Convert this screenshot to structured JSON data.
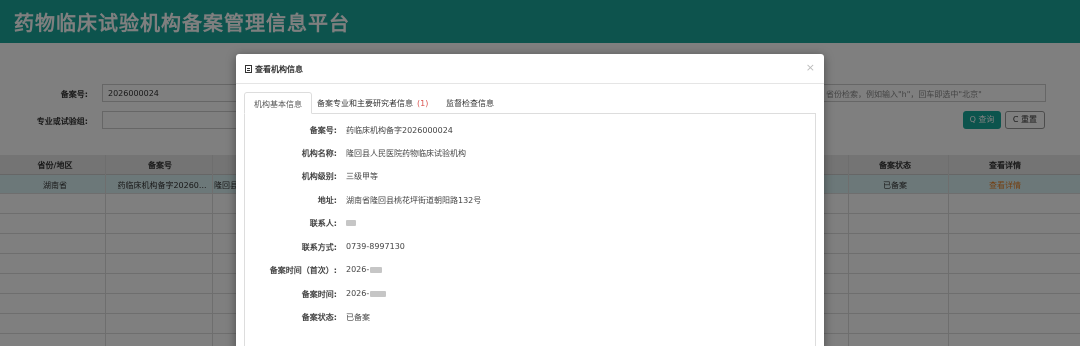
{
  "app": {
    "title": "药物临床试验机构备案管理信息平台"
  },
  "search": {
    "record_no_label": "备案号:",
    "record_no_value": "2026000024",
    "major_label": "专业或试验组:",
    "major_value": "",
    "region_placeholder": "省份检索，例如输入\"h\"，回车即选中\"北京\"",
    "search_btn": "Q 查询",
    "reset_btn": "C 重置"
  },
  "table": {
    "headers": [
      "省份/地区",
      "备案号",
      "备案状态",
      "查看详情"
    ],
    "rows": [
      {
        "province": "湖南省",
        "record_no": "药临床机构备字20260...",
        "name": "隆回县",
        "status": "已备案",
        "detail": "查看详情"
      }
    ]
  },
  "modal": {
    "title": "查看机构信息",
    "close": "×",
    "tabs": [
      {
        "label": "机构基本信息",
        "count": ""
      },
      {
        "label": "备案专业和主要研究者信息",
        "count": "(1)"
      },
      {
        "label": "监督检查信息",
        "count": ""
      }
    ],
    "fields": [
      {
        "key": "备案号:",
        "value": "药临床机构备字2026000024"
      },
      {
        "key": "机构名称:",
        "value": "隆回县人民医院药物临床试验机构"
      },
      {
        "key": "机构级别:",
        "value": "三级甲等"
      },
      {
        "key": "地址:",
        "value": "湖南省隆回县桃花坪街道朝阳路132号"
      },
      {
        "key": "联系人:",
        "value": ""
      },
      {
        "key": "联系方式:",
        "value": "0739-8997130"
      },
      {
        "key": "备案时间（首次）:",
        "value": "2026-"
      },
      {
        "key": "备案时间:",
        "value": "2026-"
      },
      {
        "key": "备案状态:",
        "value": "已备案"
      }
    ]
  },
  "colors": {
    "brand": "#1aa79b",
    "accent_red": "#d9534f",
    "link_orange": "#e67e22"
  }
}
